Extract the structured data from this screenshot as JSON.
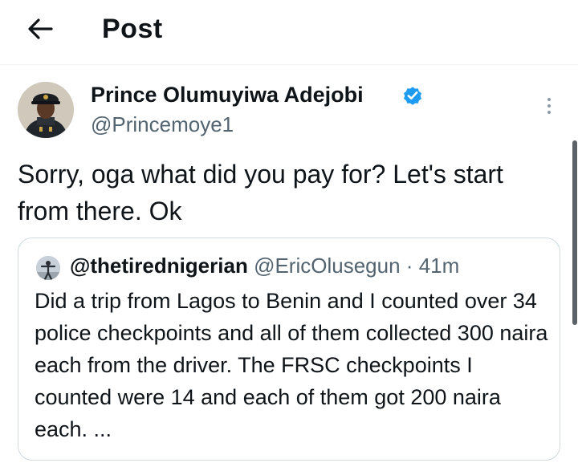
{
  "header": {
    "back_icon": "arrow-left-icon",
    "title": "Post"
  },
  "post": {
    "author_name": "Prince Olumuyiwa Adejobi",
    "author_handle": "@Princemoye1",
    "verified_icon": "verified-badge-icon",
    "more_icon": "more-vertical-icon",
    "text": "Sorry, oga what did you pay for? Let's start from there. Ok"
  },
  "quote": {
    "author_name": "@thetirednigerian",
    "author_handle": "@EricOlusegun",
    "separator": "·",
    "time": "41m",
    "text": "Did a trip from Lagos to Benin and I counted over 34 police checkpoints and all of them collected 300 naira each from the driver. The FRSC checkpoints I counted were 14 and each of them got 200 naira each. ..."
  },
  "colors": {
    "verified": "#1d9bf0",
    "secondary_text": "#536471",
    "border": "#cfd9de"
  }
}
